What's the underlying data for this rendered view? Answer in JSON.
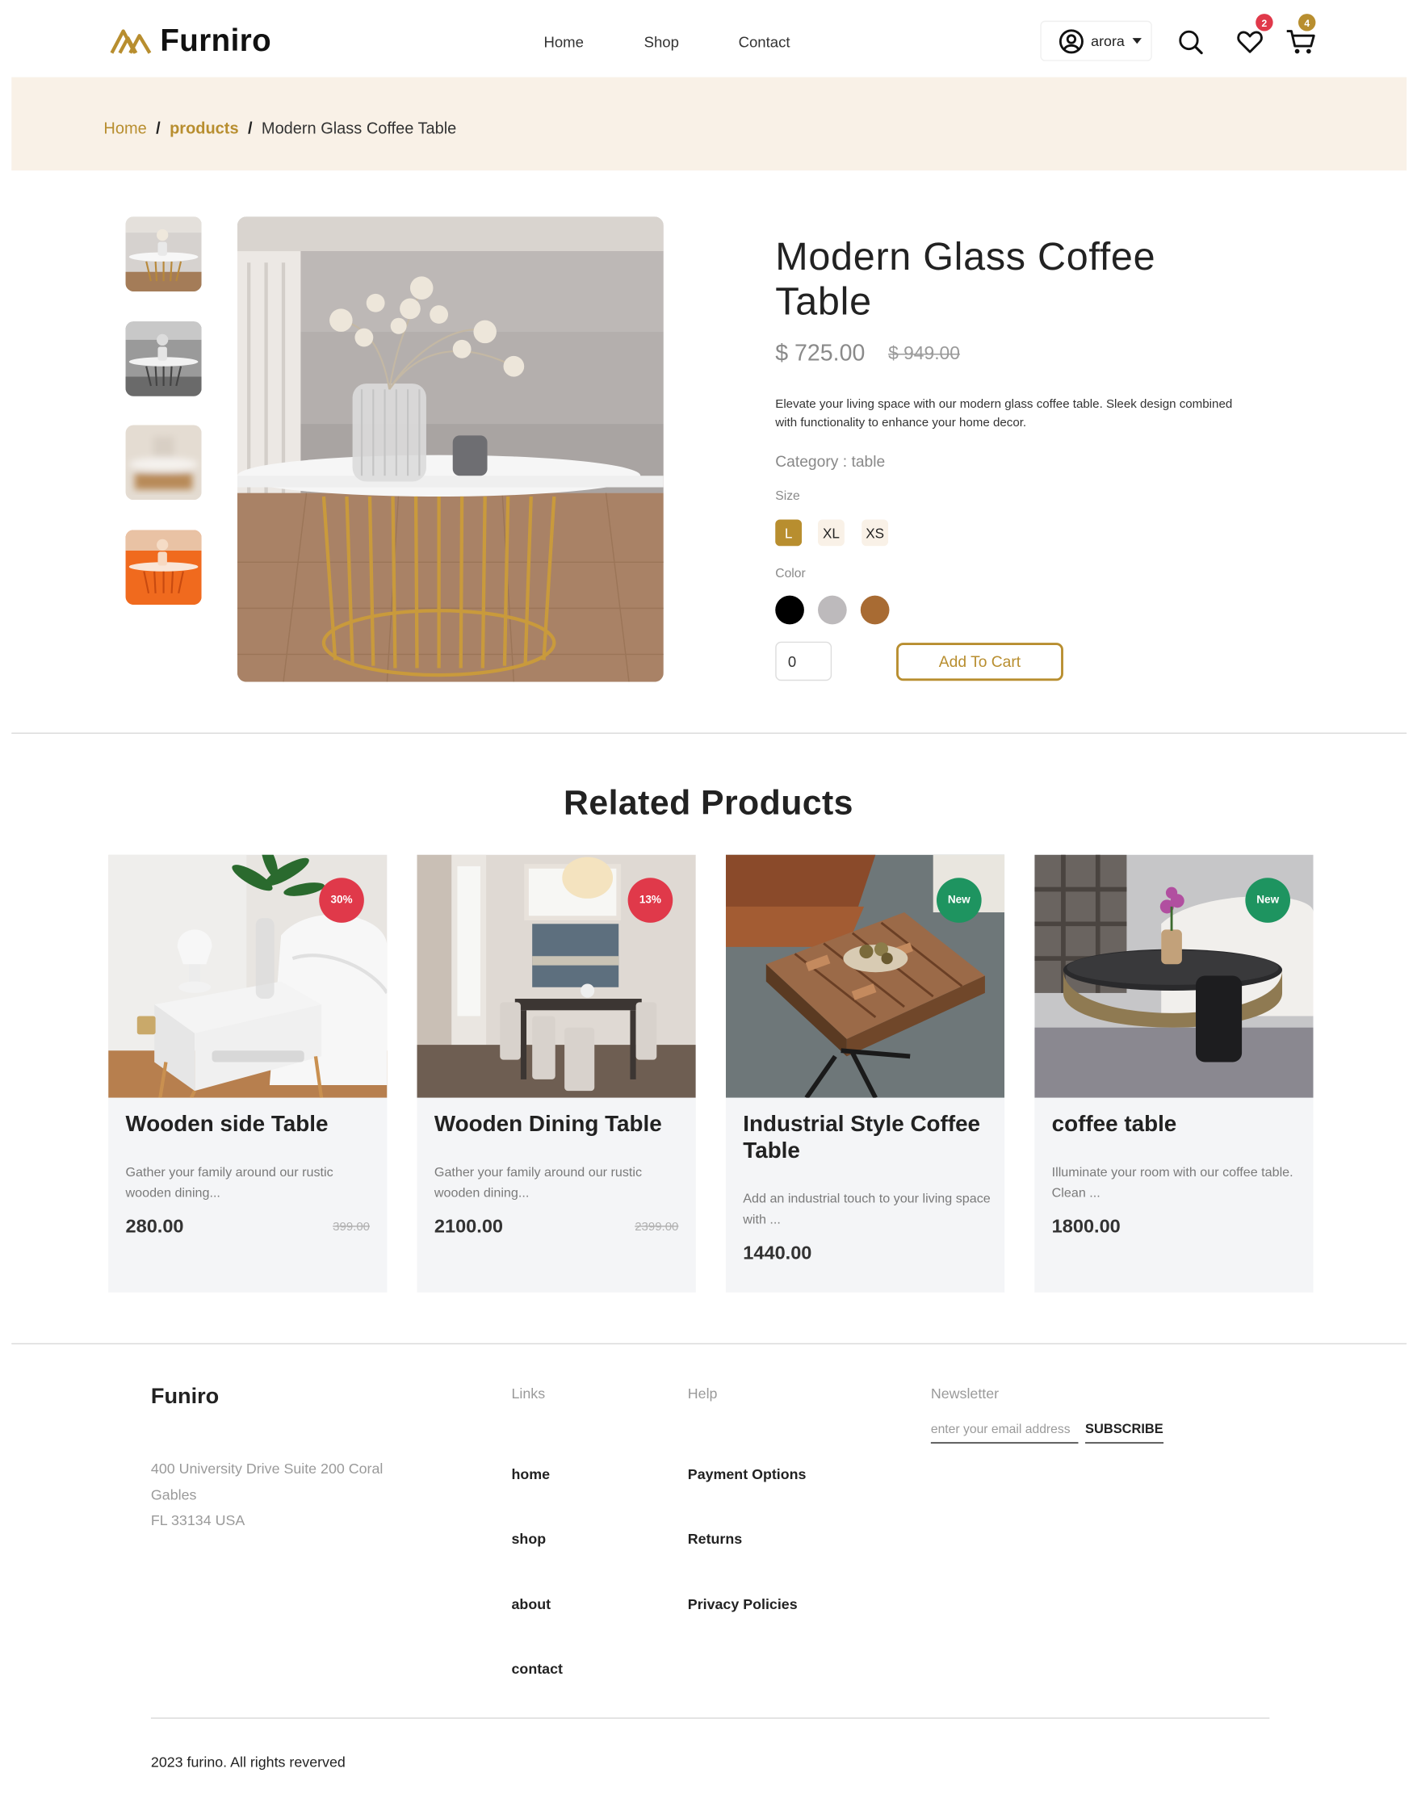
{
  "header": {
    "brand": "Furniro",
    "nav": [
      "Home",
      "Shop",
      "Contact"
    ],
    "user": "arora",
    "wishlist_count": "2",
    "cart_count": "4"
  },
  "breadcrumb": {
    "home": "Home",
    "products": "products",
    "current": "Modern Glass Coffee Table",
    "separator": "/"
  },
  "product": {
    "title": "Modern Glass Coffee Table",
    "price": "$ 725.00",
    "old_price": "$ 949.00",
    "description": "Elevate your living space with our modern glass coffee table. Sleek design combined with functionality to enhance your home decor.",
    "category_label": "Category :",
    "category": "table",
    "size_label": "Size",
    "sizes": [
      "L",
      "XL",
      "XS"
    ],
    "selected_size": "L",
    "color_label": "Color",
    "colors": [
      "#000000",
      "#bdbabc",
      "#a86b33"
    ],
    "quantity": "0",
    "add_to_cart": "Add To Cart"
  },
  "related": {
    "title": "Related Products",
    "items": [
      {
        "name": "Wooden side Table",
        "desc": "Gather your family around our rustic wooden dining...",
        "price": "280.00",
        "old_price": "399.00",
        "badge": "30%",
        "badge_color": "#e0394a"
      },
      {
        "name": "Wooden Dining Table",
        "desc": "Gather your family around our rustic wooden dining...",
        "price": "2100.00",
        "old_price": "2399.00",
        "badge": "13%",
        "badge_color": "#e0394a"
      },
      {
        "name": "Industrial Style Coffee Table",
        "desc": "Add an industrial touch to your living space with ...",
        "price": "1440.00",
        "old_price": "",
        "badge": "New",
        "badge_color": "#1e9460"
      },
      {
        "name": "coffee table",
        "desc": "Illuminate your room with our coffee table. Clean ...",
        "price": "1800.00",
        "old_price": "",
        "badge": "New",
        "badge_color": "#1e9460"
      }
    ]
  },
  "footer": {
    "brand": "Funiro",
    "address": [
      "400 University Drive Suite 200 Coral",
      "Gables",
      "FL 33134 USA"
    ],
    "links_title": "Links",
    "links": [
      "home",
      "shop",
      "about",
      "contact"
    ],
    "help_title": "Help",
    "help": [
      "Payment Options",
      "Returns",
      "Privacy Policies"
    ],
    "newsletter_title": "Newsletter",
    "newsletter_placeholder": "enter your email address",
    "subscribe": "SUBSCRIBE",
    "copyright": "2023 furino. All rights reverved"
  },
  "colors": {
    "accent": "#b88e2f",
    "band": "#f9f1e7",
    "card": "#f4f5f7",
    "sale": "#e0394a",
    "new": "#1e9460"
  }
}
